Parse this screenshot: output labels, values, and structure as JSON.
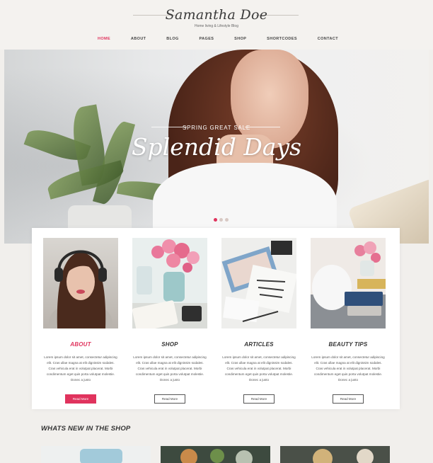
{
  "header": {
    "logo": "Samantha Doe",
    "tagline": "Home living & Lifestyle Blog"
  },
  "nav": {
    "items": [
      "HOME",
      "ABOUT",
      "BLOG",
      "PAGES",
      "SHOP",
      "SHORTCODES",
      "CONTACT"
    ],
    "active_index": 0
  },
  "hero": {
    "kicker": "SPRING GREAT SALE",
    "title": "Splendid Days",
    "slide_count": 3,
    "active_slide": 0
  },
  "cards": [
    {
      "title": "ABOUT",
      "text": "Lorem ipsum dolor sit amet, consectetur adipiscing elit. Cras ullae magna at elit dignissim sodales. Cras vehicula erat in volutpat placerat. Morbi condimentum eget quis porta volutpat molestie. Donec a justo",
      "button": "Read More",
      "highlight": true
    },
    {
      "title": "SHOP",
      "text": "Lorem ipsum dolor sit amet, consectetur adipiscing elit. Cras ullae magna at elit dignissim sodales. Cras vehicula erat in volutpat placerat. Morbi condimentum eget quis porta volutpat molestie. Donec a justo",
      "button": "Read More",
      "highlight": false
    },
    {
      "title": "ARTICLES",
      "text": "Lorem ipsum dolor sit amet, consectetur adipiscing elit. Cras ullae magna at elit dignissim sodales. Cras vehicula erat in volutpat placerat. Morbi condimentum eget quis porta volutpat molestie. Donec a justo",
      "button": "Read More",
      "highlight": false
    },
    {
      "title": "BEAUTY TIPS",
      "text": "Lorem ipsum dolor sit amet, consectetur adipiscing elit. Cras ullae magna at elit dignissim sodales. Cras vehicula erat in volutpat placerat. Morbi condimentum eget quis porta volutpat molestie. Donec a justo",
      "button": "Read More",
      "highlight": false
    }
  ],
  "shop_section": {
    "heading": "WHATS NEW IN THE SHOP"
  },
  "colors": {
    "accent": "#e0335d",
    "background": "#f1efec"
  }
}
